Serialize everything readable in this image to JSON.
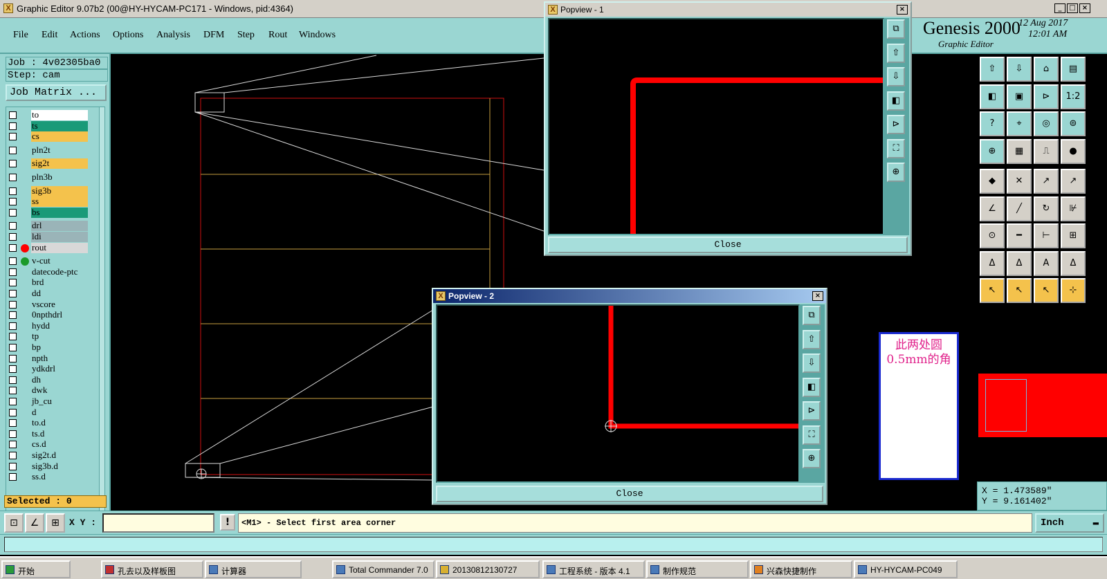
{
  "app": {
    "title": "Graphic Editor 9.07b2 (00@HY-HYCAM-PC171 - Windows, pid:4364)",
    "brand": "Genesis 2000",
    "subtitle": "Graphic Editor",
    "date": "12 Aug 2017",
    "time": "12:01 AM"
  },
  "menu": [
    "File",
    "Edit",
    "Actions",
    "Options",
    "Analysis",
    "DFM",
    "Step",
    "Rout",
    "Windows"
  ],
  "job": {
    "job_label": "Job : 4v02305ba0",
    "step_label": "Step: cam",
    "matrix_button": "Job Matrix ..."
  },
  "layers": [
    {
      "name": "to",
      "color": "#ffffff"
    },
    {
      "name": "ts",
      "color": "#1a9a78"
    },
    {
      "name": "cs",
      "color": "#f4c24c"
    },
    {
      "name": "pln2t",
      "color": "#9ad6d2"
    },
    {
      "name": "sig2t",
      "color": "#f4c24c"
    },
    {
      "name": "pln3b",
      "color": "#9ad6d2"
    },
    {
      "name": "sig3b",
      "color": "#f4c24c"
    },
    {
      "name": "ss",
      "color": "#f4c24c"
    },
    {
      "name": "bs",
      "color": "#1a9a78"
    },
    {
      "name": "drl",
      "color": "#9ab4b8"
    },
    {
      "name": "ldi",
      "color": "#9ab4b8"
    },
    {
      "name": "rout",
      "color": "#d8d8d8",
      "active": true
    },
    {
      "name": "v-cut",
      "color": "#9ad6d2",
      "dot": "#1a9a2a"
    },
    {
      "name": "datecode-ptc",
      "color": "#9ad6d2"
    },
    {
      "name": "brd",
      "color": "#9ad6d2"
    },
    {
      "name": "dd",
      "color": "#9ad6d2"
    },
    {
      "name": "vscore",
      "color": "#9ad6d2"
    },
    {
      "name": "0npthdrl",
      "color": "#9ad6d2"
    },
    {
      "name": "hydd",
      "color": "#9ad6d2"
    },
    {
      "name": "tp",
      "color": "#9ad6d2"
    },
    {
      "name": "bp",
      "color": "#9ad6d2"
    },
    {
      "name": "npth",
      "color": "#9ad6d2"
    },
    {
      "name": "ydkdrl",
      "color": "#9ad6d2"
    },
    {
      "name": "dh",
      "color": "#9ad6d2"
    },
    {
      "name": "dwk",
      "color": "#9ad6d2"
    },
    {
      "name": "jb_cu",
      "color": "#9ad6d2"
    },
    {
      "name": "d",
      "color": "#9ad6d2"
    },
    {
      "name": "to.d",
      "color": "#9ad6d2"
    },
    {
      "name": "ts.d",
      "color": "#9ad6d2"
    },
    {
      "name": "cs.d",
      "color": "#9ad6d2"
    },
    {
      "name": "sig2t.d",
      "color": "#9ad6d2"
    },
    {
      "name": "sig3b.d",
      "color": "#9ad6d2"
    },
    {
      "name": "ss.d",
      "color": "#9ad6d2"
    }
  ],
  "selected": "Selected : 0",
  "popview1": {
    "title": "Popview - 1",
    "close": "Close"
  },
  "popview2": {
    "title": "Popview - 2",
    "close": "Close"
  },
  "note": "此两处圆0.5mm的角",
  "coords": {
    "x": "X = 1.473589\"",
    "y": "Y = 9.161402\""
  },
  "status": {
    "xy_label": "X Y :",
    "xy_value": "",
    "message": "<M1> - Select first area corner",
    "unit": "Inch"
  },
  "colors": {
    "panel": "#9ad6d2",
    "accent": "#f4c24c",
    "rout": "#ff0000",
    "popview_title": "#0a246a"
  },
  "taskbar": [
    "开始",
    "孔去以及样板图",
    "计算器",
    "Total Commander 7.0",
    "20130812130727",
    "工程系统 - 版本 4.1",
    "制作规范",
    "兴森快捷制作",
    "HY-HYCAM-PC049"
  ],
  "toolbar_icons": [
    "zoom-home-icon",
    "zoom-in-icon",
    "zoom-out-icon",
    "zoom-window-icon",
    "pan-left-icon",
    "pan-right-icon",
    "fit-icon",
    "one-to-one-icon",
    "help-icon",
    "snap-icon",
    "measure-icon",
    "highlight-icon",
    "net-icon",
    "display-icon",
    "ruler-icon",
    "fill-icon",
    "feature-icon",
    "delete-icon",
    "move-icon",
    "copy-icon",
    "edit-line-icon",
    "cut-icon",
    "arc-icon",
    "polygon-icon",
    "add-pad-icon",
    "add-line-icon",
    "resize-icon",
    "mirror-icon",
    "text-a-icon",
    "text-b-icon",
    "text-c-icon",
    "text-d-icon",
    "select-icon",
    "select-box-icon",
    "select-poly-icon",
    "route-icon"
  ]
}
